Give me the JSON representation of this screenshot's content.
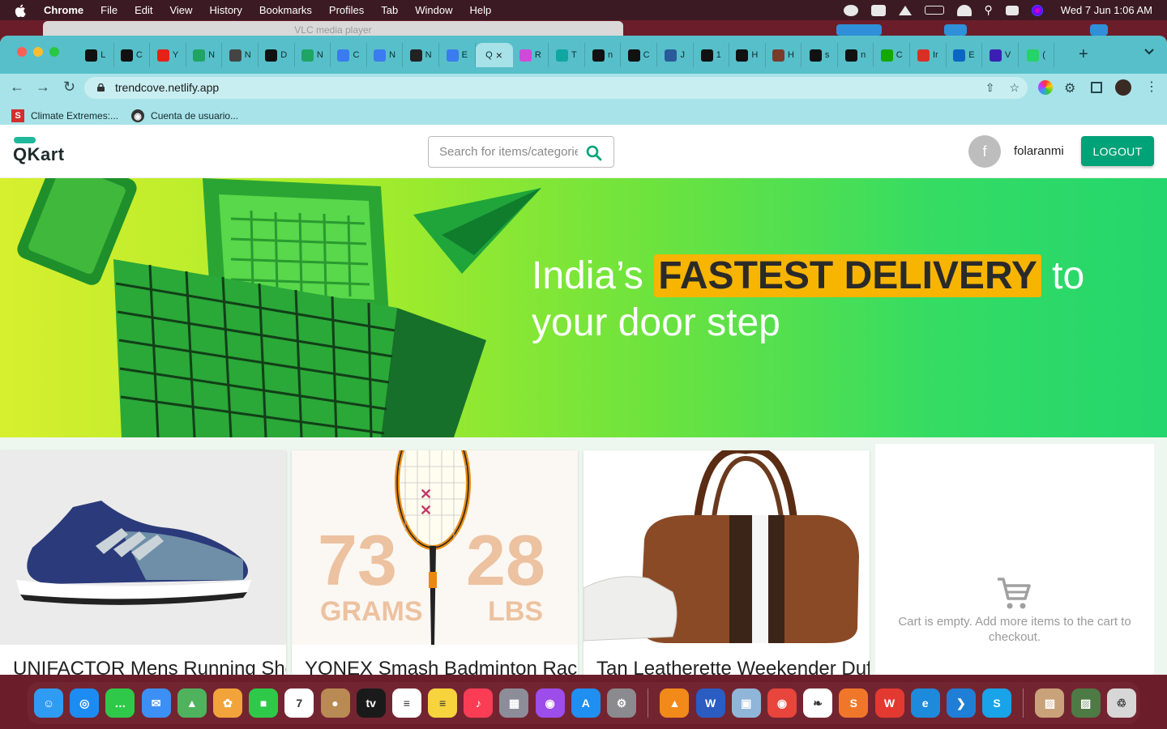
{
  "menubar": {
    "app": "Chrome",
    "items": [
      "File",
      "Edit",
      "View",
      "History",
      "Bookmarks",
      "Profiles",
      "Tab",
      "Window",
      "Help"
    ],
    "clock": "Wed 7 Jun  1:06 AM"
  },
  "background_window": {
    "title": "VLC media player"
  },
  "browser": {
    "tabs": [
      {
        "letter": "L",
        "icon": "circle-dark-icon",
        "color": "#111"
      },
      {
        "letter": "C",
        "icon": "x-logo-icon",
        "color": "#111"
      },
      {
        "letter": "Y",
        "icon": "youtube-icon",
        "color": "#e62117"
      },
      {
        "letter": "N",
        "icon": "drive-icon",
        "color": "#1fa463"
      },
      {
        "letter": "N",
        "icon": "openai-icon",
        "color": "#444"
      },
      {
        "letter": "D",
        "icon": "github-icon",
        "color": "#111"
      },
      {
        "letter": "N",
        "icon": "drive-icon",
        "color": "#1fa463"
      },
      {
        "letter": "C",
        "icon": "docs-icon",
        "color": "#3b7bf0"
      },
      {
        "letter": "N",
        "icon": "docs-icon",
        "color": "#3b7bf0"
      },
      {
        "letter": "N",
        "icon": "globe-icon",
        "color": "#222"
      },
      {
        "letter": "E",
        "icon": "docs-icon",
        "color": "#3b7bf0"
      },
      {
        "letter": "Q",
        "icon": "qkart-icon",
        "color": "#a6e2e8",
        "active": true
      },
      {
        "letter": "R",
        "icon": "react-icon",
        "color": "#d04ad9"
      },
      {
        "letter": "T",
        "icon": "diamond-icon",
        "color": "#10a7a0"
      },
      {
        "letter": "n",
        "icon": "github-icon",
        "color": "#111"
      },
      {
        "letter": "C",
        "icon": "github-icon",
        "color": "#111"
      },
      {
        "letter": "J",
        "icon": "keyboard-icon",
        "color": "#2a5a9a"
      },
      {
        "letter": "1",
        "icon": "github-icon",
        "color": "#111"
      },
      {
        "letter": "H",
        "icon": "code-icon",
        "color": "#111"
      },
      {
        "letter": "H",
        "icon": "photo-icon",
        "color": "#7a3b2a"
      },
      {
        "letter": "s",
        "icon": "github-icon",
        "color": "#111"
      },
      {
        "letter": "n",
        "icon": "github-icon",
        "color": "#111"
      },
      {
        "letter": "C",
        "icon": "upwork-icon",
        "color": "#14a800"
      },
      {
        "letter": "Ir",
        "icon": "gmail-icon",
        "color": "#d93025"
      },
      {
        "letter": "E",
        "icon": "linkedin-icon",
        "color": "#0a66c2"
      },
      {
        "letter": "V",
        "icon": "v-icon",
        "color": "#3b1fb5"
      },
      {
        "letter": "(",
        "icon": "whatsapp-icon",
        "color": "#25d366"
      }
    ],
    "url": "trendcove.netlify.app",
    "bookmarks": [
      {
        "label": "Climate Extremes:...",
        "icon": "s-red-icon",
        "color": "#d32f2f"
      },
      {
        "label": "Cuenta de usuario...",
        "icon": "globe-icon",
        "color": "#333"
      }
    ]
  },
  "qkart": {
    "logo": "QKart",
    "search": {
      "placeholder": "Search for items/categories",
      "value": ""
    },
    "user": {
      "avatar_letter": "f",
      "name": "folaranmi"
    },
    "logout_label": "LOGOUT",
    "hero": {
      "pre": "India’s ",
      "highlight": "FASTEST DELIVERY",
      "post": " to",
      "line2": "your door step"
    },
    "products": [
      {
        "name": "UNIFACTOR Mens Running Shoes"
      },
      {
        "name": "YONEX Smash Badminton Racquet",
        "overlay_left_num": "73",
        "overlay_left_unit": "GRAMS",
        "overlay_right_num": "28",
        "overlay_right_unit": "LBS"
      },
      {
        "name": "Tan Leatherette Weekender Duffle"
      }
    ],
    "cart_empty_message": "Cart is empty. Add more items to the cart to checkout."
  },
  "dock": {
    "apps": [
      {
        "name": "finder-icon",
        "color": "#2f9bf3",
        "glyph": "☺"
      },
      {
        "name": "safari-icon",
        "color": "#1d8cf2",
        "glyph": "◎"
      },
      {
        "name": "messages-icon",
        "color": "#2fc94a",
        "glyph": "…"
      },
      {
        "name": "mail-icon",
        "color": "#3c8ff5",
        "glyph": "✉"
      },
      {
        "name": "maps-icon",
        "color": "#4fb35e",
        "glyph": "▲"
      },
      {
        "name": "photos-icon",
        "color": "#f2a33a",
        "glyph": "✿"
      },
      {
        "name": "facetime-icon",
        "color": "#2fc94a",
        "glyph": "■"
      },
      {
        "name": "calendar-icon",
        "color": "#ffffff",
        "glyph": "7"
      },
      {
        "name": "contacts-icon",
        "color": "#b98a54",
        "glyph": "●"
      },
      {
        "name": "appletv-icon",
        "color": "#1a1a1a",
        "glyph": "tv"
      },
      {
        "name": "reminders-icon",
        "color": "#ffffff",
        "glyph": "≡"
      },
      {
        "name": "notes-icon",
        "color": "#f7d33e",
        "glyph": "≡"
      },
      {
        "name": "music-icon",
        "color": "#fa3d55",
        "glyph": "♪"
      },
      {
        "name": "launchpad-icon",
        "color": "#8d8d99",
        "glyph": "▦"
      },
      {
        "name": "podcasts-icon",
        "color": "#9c4dea",
        "glyph": "◉"
      },
      {
        "name": "appstore-icon",
        "color": "#1f8ff2",
        "glyph": "A"
      },
      {
        "name": "settings-icon",
        "color": "#8a8a8f",
        "glyph": "⚙"
      },
      {
        "name": "vlc-icon",
        "color": "#f28a1a",
        "glyph": "▲"
      },
      {
        "name": "word-icon",
        "color": "#2a5cc2",
        "glyph": "W"
      },
      {
        "name": "preview-icon",
        "color": "#8fb6d8",
        "glyph": "▣"
      },
      {
        "name": "chrome-icon",
        "color": "#e8453c",
        "glyph": "◉"
      },
      {
        "name": "mongodb-icon",
        "color": "#ffffff",
        "glyph": "❧"
      },
      {
        "name": "sublime-icon",
        "color": "#f0772a",
        "glyph": "S"
      },
      {
        "name": "wps-icon",
        "color": "#e23a31",
        "glyph": "W"
      },
      {
        "name": "edge-icon",
        "color": "#1d8adb",
        "glyph": "e"
      },
      {
        "name": "vscode-icon",
        "color": "#1f7fd6",
        "glyph": "❯"
      },
      {
        "name": "skype-icon",
        "color": "#19a3e8",
        "glyph": "S"
      },
      {
        "name": "image-file-icon",
        "color": "#c9a27a",
        "glyph": "▨"
      },
      {
        "name": "image-file-icon",
        "color": "#4e7a45",
        "glyph": "▨"
      },
      {
        "name": "trash-icon",
        "color": "#d7d7d7",
        "glyph": "♲"
      }
    ]
  },
  "colors": {
    "qkart_green": "#00a278",
    "highlight_yellow": "#f7b500",
    "tab_bar": "#57bfc9",
    "toolbar": "#a8e3e9"
  }
}
